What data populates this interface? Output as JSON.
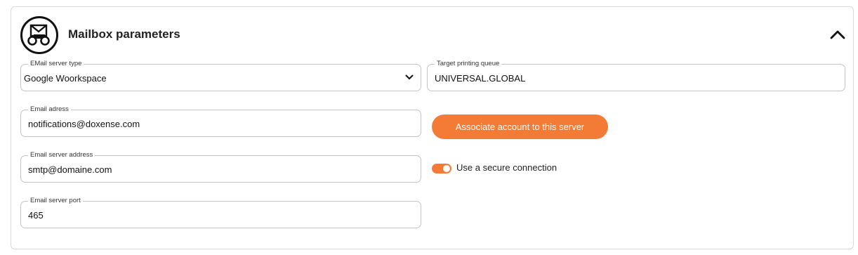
{
  "panel": {
    "title": "Mailbox parameters",
    "header_icon": "mailbox-binoculars-icon",
    "collapse_icon": "chevron-up-icon"
  },
  "fields": {
    "server_type": {
      "label": "EMail server type",
      "value": "Google Woorkspace"
    },
    "printing_queue": {
      "label": "Target printing queue",
      "value": "UNIVERSAL.GLOBAL"
    },
    "email_address": {
      "label": "Email adress",
      "value": "notifications@doxense.com"
    },
    "server_address": {
      "label": "Email server address",
      "value": "smtp@domaine.com"
    },
    "server_port": {
      "label": "Email server port",
      "value": "465"
    }
  },
  "actions": {
    "associate_label": "Associate account to this server"
  },
  "secure_connection": {
    "label": "Use a secure connection",
    "enabled": true
  },
  "colors": {
    "accent": "#f47b36",
    "border": "#c4c4c4"
  }
}
